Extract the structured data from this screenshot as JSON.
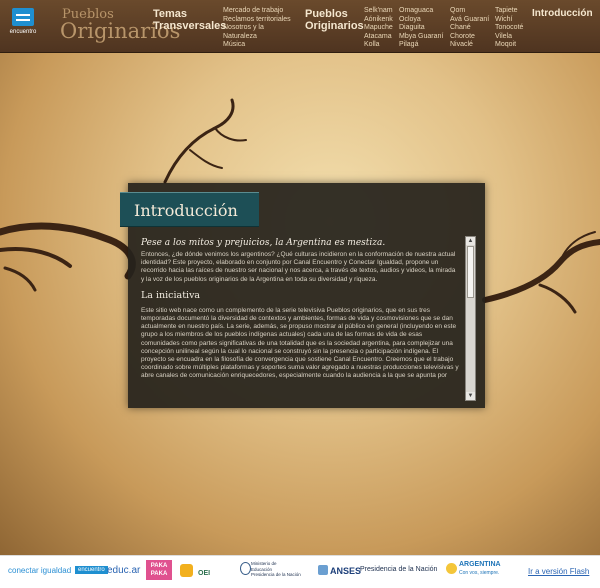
{
  "header": {
    "brand_encuentro": "encuentro",
    "brand_pueblos_l1": "Pueblos",
    "brand_pueblos_l2": "Originarios",
    "temas_head_l1": "Temas",
    "temas_head_l2": "Transversales",
    "temas_items": [
      "Mercado de trabajo",
      "Reclamos territoriales",
      "Nosotros y la",
      "Naturaleza",
      "Música"
    ],
    "pueblos_head_l1": "Pueblos",
    "pueblos_head_l2": "Originarios",
    "pueblos_col1": [
      "Selk'nam",
      "Aónikenk",
      "Mapuche",
      "Atacama",
      "Kolla"
    ],
    "pueblos_col2": [
      "Omaguaca",
      "Ocloya",
      "Diaguita",
      "Mbya Guaraní",
      "Pilagá"
    ],
    "pueblos_col3": [
      "Qom",
      "Avá Guaraní",
      "Chané",
      "Chorote",
      "Nivaclé"
    ],
    "pueblos_col4": [
      "Tapiete",
      "Wichí",
      "Tonocoté",
      "Vilela",
      "Moqoit"
    ],
    "intro_link": "Introducción"
  },
  "panel": {
    "title": "Introducción",
    "lead": "Pese a los mitos y prejuicios, la Argentina es mestiza.",
    "p1": "Entonces, ¿de dónde venimos los argentinos? ¿Qué culturas incidieron en la conformación de nuestra actual identidad? Este proyecto, elaborado en conjunto por Canal Encuentro y Conectar Igualdad, propone un recorrido hacia las raíces de nuestro ser nacional y nos acerca, a través de textos, audios y videos, la mirada y la voz de los pueblos originarios de la Argentina en toda su diversidad y riqueza.",
    "subhead": "La iniciativa",
    "p2": "Este sitio web nace como un complemento de la serie televisiva Pueblos originarios, que en sus tres temporadas documentó la diversidad de contextos y ambientes, formas de vida y cosmovisiones que se dan actualmente en nuestro país. La serie, además, se propuso mostrar al público en general (incluyendo en este grupo a los miembros de los pueblos indígenas actuales) cada una de las formas de vida de esas comunidades como partes significativas de una totalidad que es la sociedad argentina, para complejizar una concepción unilineal según la cual lo nacional se construyó sin la presencia o participación indígena. El proyecto se encuadra en la filosofía de convergencia que sostiene Canal Encuentro. Creemos que el trabajo coordinado sobre múltiples plataformas y soportes suma valor agregado a nuestras producciones televisivas y abre canales de comunicación enriquecedores, especialmente cuando la audiencia a la que se apunta por"
  },
  "footer": {
    "conectar": "conectar igualdad",
    "encuentro": "encuentro",
    "educar": "educ.ar",
    "pakapaka": "PAKA PAKA",
    "oei": "OEI",
    "ministerio_l1": "Ministerio de",
    "ministerio_l2": "Educación",
    "ministerio_l3": "Presidencia de la Nación",
    "anses": "ANSES",
    "presidencia": "Presidencia de la Nación",
    "argentina": "ARGENTINA",
    "argentina_sub": "Con vos, siempre.",
    "flash_link": "Ir a versión Flash"
  }
}
